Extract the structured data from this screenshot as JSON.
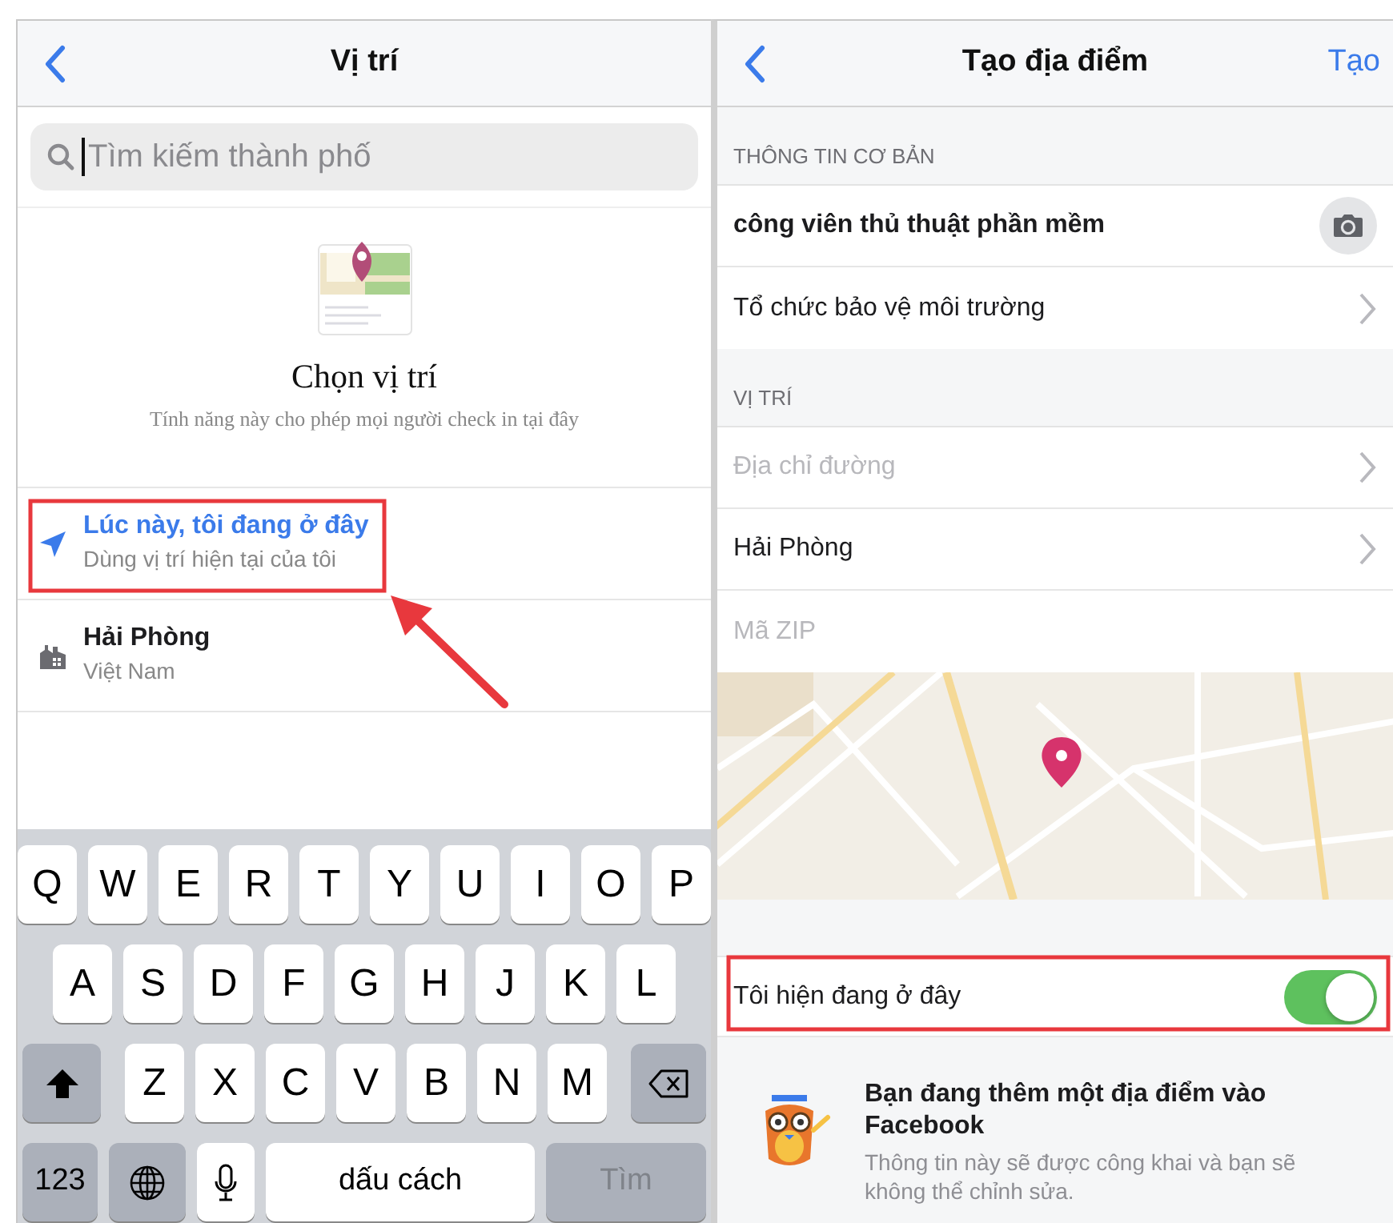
{
  "left_screen": {
    "title": "Vị trí",
    "search": {
      "placeholder": "Tìm kiếm thành phố"
    },
    "empty_state": {
      "title": "Chọn vị trí",
      "subtitle": "Tính năng này cho phép mọi người check in tại đây"
    },
    "locations": [
      {
        "kind": "current",
        "title": "Lúc này, tôi đang ở đây",
        "subtitle": "Dùng vị trí hiện tại của tôi"
      },
      {
        "kind": "city",
        "title": "Hải Phòng",
        "subtitle": "Việt Nam"
      }
    ],
    "keyboard": {
      "rows": [
        {
          "keys": [
            {
              "kind": "letter",
              "label": "Q"
            },
            {
              "kind": "letter",
              "label": "W"
            },
            {
              "kind": "letter",
              "label": "E"
            },
            {
              "kind": "letter",
              "label": "R"
            },
            {
              "kind": "letter",
              "label": "T"
            },
            {
              "kind": "letter",
              "label": "Y"
            },
            {
              "kind": "letter",
              "label": "U"
            },
            {
              "kind": "letter",
              "label": "I"
            },
            {
              "kind": "letter",
              "label": "O"
            },
            {
              "kind": "letter",
              "label": "P"
            }
          ]
        },
        {
          "keys": [
            {
              "kind": "letter",
              "label": "A"
            },
            {
              "kind": "letter",
              "label": "S"
            },
            {
              "kind": "letter",
              "label": "D"
            },
            {
              "kind": "letter",
              "label": "F"
            },
            {
              "kind": "letter",
              "label": "G"
            },
            {
              "kind": "letter",
              "label": "H"
            },
            {
              "kind": "letter",
              "label": "J"
            },
            {
              "kind": "letter",
              "label": "K"
            },
            {
              "kind": "letter",
              "label": "L"
            }
          ]
        },
        {
          "keys": [
            {
              "kind": "shift"
            },
            {
              "kind": "letter",
              "label": "Z"
            },
            {
              "kind": "letter",
              "label": "X"
            },
            {
              "kind": "letter",
              "label": "C"
            },
            {
              "kind": "letter",
              "label": "V"
            },
            {
              "kind": "letter",
              "label": "B"
            },
            {
              "kind": "letter",
              "label": "N"
            },
            {
              "kind": "letter",
              "label": "M"
            },
            {
              "kind": "delete"
            }
          ]
        },
        {
          "keys": [
            {
              "kind": "numbers",
              "label": "123"
            },
            {
              "kind": "globe"
            },
            {
              "kind": "mic"
            },
            {
              "kind": "space",
              "label": "dấu cách"
            },
            {
              "kind": "action",
              "label": "Tìm"
            }
          ]
        }
      ]
    }
  },
  "right_screen": {
    "title": "Tạo địa điểm",
    "action": "Tạo",
    "sections": [
      {
        "header": "THÔNG TIN CƠ BẢN",
        "rows": [
          {
            "kind": "name",
            "value": "công viên thủ thuật phần mềm"
          },
          {
            "kind": "link",
            "value": "Tổ chức bảo vệ môi trường"
          }
        ]
      },
      {
        "header": "VỊ TRÍ",
        "rows": [
          {
            "kind": "link",
            "placeholder": "Địa chỉ đường"
          },
          {
            "kind": "link",
            "value": "Hải Phòng"
          },
          {
            "kind": "field",
            "placeholder": "Mã ZIP"
          }
        ]
      }
    ],
    "toggle": {
      "label": "Tôi hiện đang ở đây",
      "on": true
    },
    "notice": {
      "title": "Bạn đang thêm một địa điểm vào Facebook",
      "text": "Thông tin này sẽ được công khai và bạn sẽ không thể chỉnh sửa."
    }
  }
}
